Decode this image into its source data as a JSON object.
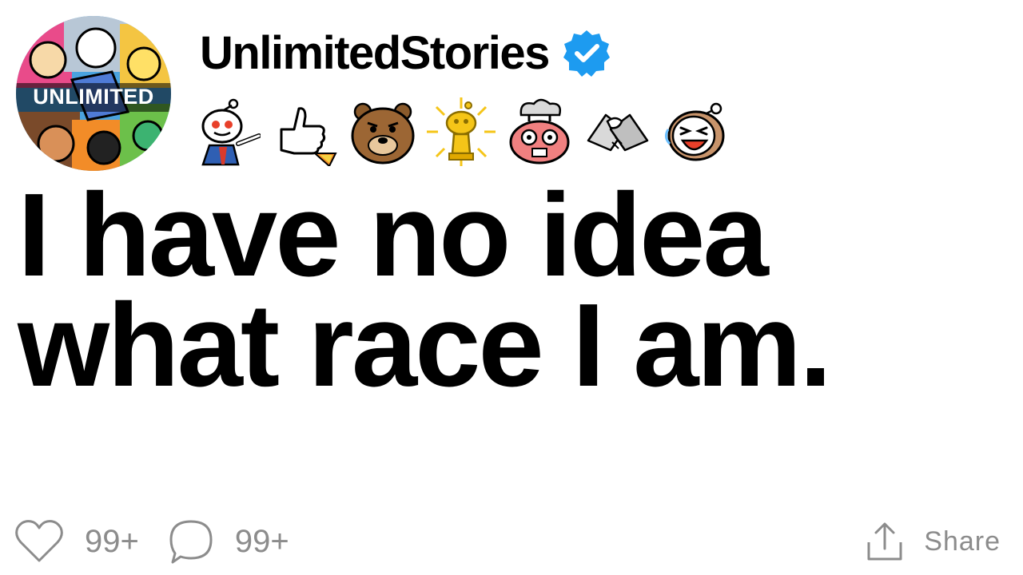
{
  "header": {
    "username": "UnlimitedStories",
    "verified_icon": "verified-badge-icon",
    "avatar_text": "UNLIMITED"
  },
  "awards": [
    {
      "name": "pointing-snoo-award-icon"
    },
    {
      "name": "thumbs-up-rocket-award-icon"
    },
    {
      "name": "bear-award-icon"
    },
    {
      "name": "golden-snoo-award-icon"
    },
    {
      "name": "mind-blown-award-icon"
    },
    {
      "name": "handshake-award-icon"
    },
    {
      "name": "laughing-snoo-award-icon"
    }
  ],
  "post": {
    "title": "I have no idea what race I am."
  },
  "footer": {
    "likes_count": "99+",
    "comments_count": "99+",
    "share_label": "Share"
  },
  "colors": {
    "verified_blue": "#1d9bf0",
    "footer_gray": "#8c8c8c"
  }
}
